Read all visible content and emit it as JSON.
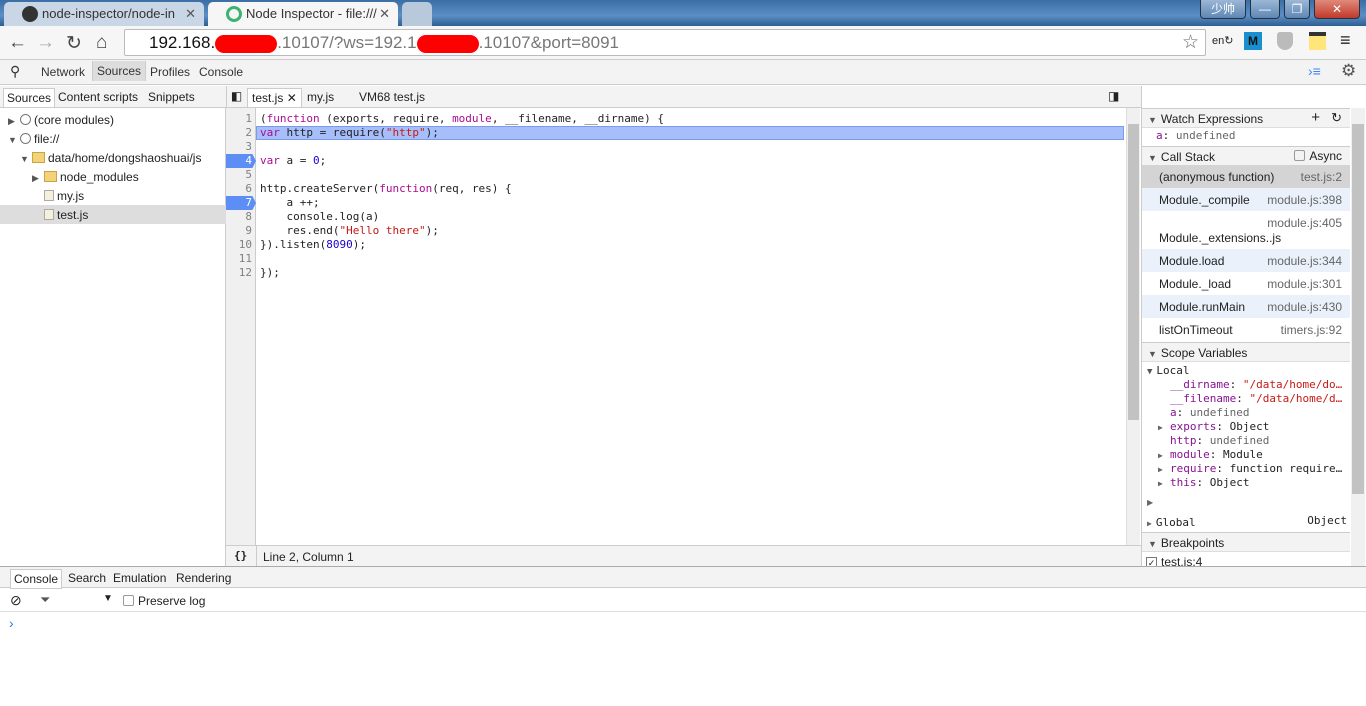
{
  "browser": {
    "tabs": [
      {
        "title": "node-inspector/node-in",
        "active": false
      },
      {
        "title": "Node Inspector - file:///",
        "active": true
      }
    ],
    "user_badge": "少帅",
    "url_host": "192.168.",
    "url_mid": ".10107/?ws=192.1",
    "url_tail": ".10107&port=8091",
    "extension_m": "M"
  },
  "devtools": {
    "panels": [
      {
        "label": "Network"
      },
      {
        "label": "Sources",
        "active": true
      },
      {
        "label": "Profiles"
      },
      {
        "label": "Console"
      }
    ],
    "nav_tabs": [
      "Sources",
      "Content scripts",
      "Snippets"
    ],
    "editor_tabs": [
      {
        "label": "test.js",
        "closable": true,
        "active": true
      },
      {
        "label": "my.js"
      },
      {
        "label": "VM68 test.js"
      }
    ],
    "tree": [
      {
        "label": "(core modules)",
        "icon": "globe-icon",
        "level": 0,
        "expanded": false
      },
      {
        "label": "file://",
        "icon": "globe-icon",
        "level": 0,
        "expanded": true
      },
      {
        "label": "data/home/dongshaoshuai/js",
        "icon": "folder-icon",
        "level": 1,
        "expanded": true
      },
      {
        "label": "node_modules",
        "icon": "folder-icon",
        "level": 2,
        "expanded": false
      },
      {
        "label": "my.js",
        "icon": "file-icon",
        "level": 2
      },
      {
        "label": "test.js",
        "icon": "file-icon",
        "level": 2,
        "selected": true
      }
    ],
    "code": [
      [
        [
          "p",
          "("
        ],
        [
          "kw",
          "function"
        ],
        [
          "p",
          " (exports, require, "
        ],
        [
          "kw",
          "module"
        ],
        [
          "p",
          ", __filename, __dirname) {"
        ]
      ],
      [
        [
          "kw",
          "var"
        ],
        [
          "p",
          " http = require("
        ],
        [
          "str",
          "\"http\""
        ],
        [
          "p",
          ");"
        ]
      ],
      [],
      [
        [
          "kw",
          "var"
        ],
        [
          "p",
          " a = "
        ],
        [
          "num",
          "0"
        ],
        [
          "p",
          ";"
        ]
      ],
      [],
      [
        [
          "p",
          "http.createServer("
        ],
        [
          "kw",
          "function"
        ],
        [
          "p",
          "(req, res) {"
        ]
      ],
      [
        [
          "p",
          "    a ++;"
        ]
      ],
      [
        [
          "p",
          "    console.log(a)"
        ]
      ],
      [
        [
          "p",
          "    res.end("
        ],
        [
          "str",
          "\"Hello there\""
        ],
        [
          "p",
          ");"
        ]
      ],
      [
        [
          "p",
          "}).listen("
        ],
        [
          "num",
          "8090"
        ],
        [
          "p",
          ");"
        ]
      ],
      [],
      [
        [
          "p",
          "});"
        ]
      ]
    ],
    "current_line": 2,
    "breakpoint_lines": [
      4,
      7
    ],
    "status": "Line 2, Column 1",
    "watch": {
      "title": "Watch Expressions",
      "items": [
        {
          "name": "a",
          "value": "undefined"
        }
      ]
    },
    "callstack": {
      "title": "Call Stack",
      "async_label": "Async",
      "frames": [
        {
          "name": "(anonymous function)",
          "loc": "test.js:2",
          "selected": true
        },
        {
          "name": "Module._compile",
          "loc": "module.js:398"
        },
        {
          "name": "Module._extensions..js",
          "loc": "module.js:405"
        },
        {
          "name": "Module.load",
          "loc": "module.js:344"
        },
        {
          "name": "Module._load",
          "loc": "module.js:301"
        },
        {
          "name": "Module.runMain",
          "loc": "module.js:430"
        },
        {
          "name": "listOnTimeout",
          "loc": "timers.js:92"
        }
      ]
    },
    "scope": {
      "title": "Scope Variables",
      "local_label": "Local",
      "vars": [
        {
          "name": "__dirname",
          "value": "\"/data/home/do…",
          "type": "str"
        },
        {
          "name": "__filename",
          "value": "\"/data/home/d…",
          "type": "str"
        },
        {
          "name": "a",
          "value": "undefined",
          "type": "gr"
        },
        {
          "name": "exports",
          "value": "Object",
          "expandable": true
        },
        {
          "name": "http",
          "value": "undefined",
          "type": "gr"
        },
        {
          "name": "module",
          "value": "Module",
          "expandable": true
        },
        {
          "name": "require",
          "value": "function require…",
          "expandable": true
        },
        {
          "name": "this",
          "value": "Object",
          "expandable": true
        }
      ],
      "global_label": "Global",
      "global_value": "Object"
    },
    "breakpoints": {
      "title": "Breakpoints",
      "items": [
        {
          "label": "test.js:4",
          "checked": true
        }
      ]
    },
    "drawer_tabs": [
      "Console",
      "Search",
      "Emulation",
      "Rendering"
    ],
    "preserve_log": "Preserve log",
    "prompt": "›"
  }
}
